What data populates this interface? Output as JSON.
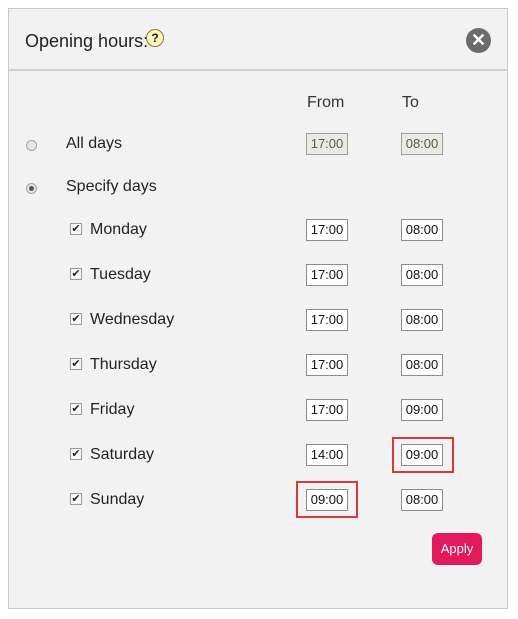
{
  "dialog": {
    "title": "Opening hours:",
    "help_glyph": "?",
    "close_glyph": "✕"
  },
  "columns": {
    "from": "From",
    "to": "To"
  },
  "all_days": {
    "label": "All days",
    "from": "17:00",
    "to": "08:00",
    "selected": false
  },
  "specify_days": {
    "label": "Specify days",
    "selected": true
  },
  "days": [
    {
      "label": "Monday",
      "checked": true,
      "from": "17:00",
      "to": "08:00"
    },
    {
      "label": "Tuesday",
      "checked": true,
      "from": "17:00",
      "to": "08:00"
    },
    {
      "label": "Wednesday",
      "checked": true,
      "from": "17:00",
      "to": "08:00"
    },
    {
      "label": "Thursday",
      "checked": true,
      "from": "17:00",
      "to": "08:00"
    },
    {
      "label": "Friday",
      "checked": true,
      "from": "17:00",
      "to": "09:00"
    },
    {
      "label": "Saturday",
      "checked": true,
      "from": "14:00",
      "to": "09:00"
    },
    {
      "label": "Sunday",
      "checked": true,
      "from": "09:00",
      "to": "08:00"
    }
  ],
  "apply_label": "Apply",
  "check_glyph": "✔",
  "colors": {
    "apply": "#e2195b",
    "highlight": "#d9383d"
  }
}
